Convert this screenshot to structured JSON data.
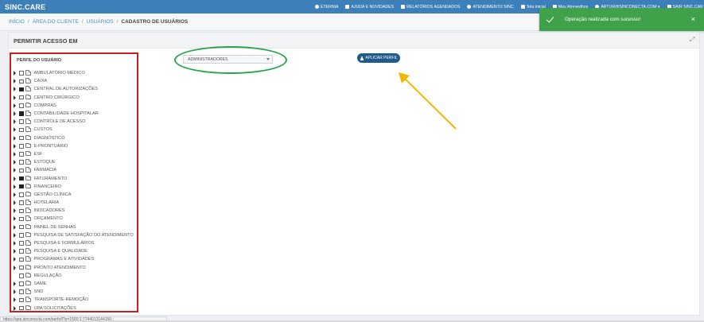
{
  "app": {
    "brand": "SINC.CARE"
  },
  "nav": [
    {
      "icon": "eternia-icon",
      "label": "ETERNIA"
    },
    {
      "icon": "help-icon",
      "label": "AJUDA E NOVIDADES"
    },
    {
      "icon": "report-icon",
      "label": "RELATÓRIOS AGENDADOS"
    },
    {
      "icon": "support-icon",
      "label": "ATENDIMENTO SINC"
    },
    {
      "icon": "home-icon",
      "label": "Tela Inicial"
    },
    {
      "icon": "shortcut-icon",
      "label": "Meu Atrevedhos"
    },
    {
      "icon": "user-icon",
      "label": "ARTUR@SINCONECTA.COM ▾"
    },
    {
      "icon": "logout-icon",
      "label": "SAIR SINC.CAR"
    }
  ],
  "breadcrumb": {
    "items": [
      "INÍCIO",
      "ÁREA DO CLIENTE",
      "USUÁRIOS"
    ],
    "separator": "/",
    "current": "CADASTRO DE USUÁRIOS"
  },
  "toast": {
    "message": "Operação realizada com sucesso!",
    "close": "×",
    "color": "#3fa24a"
  },
  "panel": {
    "title": "PERMITIR ACESSO EM"
  },
  "tree": {
    "title": "PERFIL DO USUÁRIO",
    "items": [
      {
        "label": "AMBULATÓRIO MÉDICO",
        "checked": false,
        "expandable": true
      },
      {
        "label": "CAIXA",
        "checked": false,
        "expandable": true
      },
      {
        "label": "CENTRAL DE AUTORIZAÇÕES",
        "checked": true,
        "expandable": true
      },
      {
        "label": "CENTRO CIRÚRGICO",
        "checked": false,
        "expandable": true
      },
      {
        "label": "COMPRAS",
        "checked": false,
        "expandable": true
      },
      {
        "label": "CONTABILIDADE HOSPITALAR",
        "checked": true,
        "expandable": true
      },
      {
        "label": "CONTROLE DE ACESSO",
        "checked": false,
        "expandable": true
      },
      {
        "label": "CUSTOS",
        "checked": false,
        "expandable": true
      },
      {
        "label": "DIAGNÓSTICO",
        "checked": false,
        "expandable": true
      },
      {
        "label": "E-PRONTUÁRIO",
        "checked": false,
        "expandable": true
      },
      {
        "label": "ESF",
        "checked": false,
        "expandable": true
      },
      {
        "label": "ESTOQUE",
        "checked": false,
        "expandable": true
      },
      {
        "label": "FARMÁCIA",
        "checked": false,
        "expandable": true
      },
      {
        "label": "FATURAMENTO",
        "checked": true,
        "expandable": true
      },
      {
        "label": "FINANCEIRO",
        "checked": true,
        "expandable": true
      },
      {
        "label": "GESTÃO CLÍNICA",
        "checked": false,
        "expandable": true
      },
      {
        "label": "HOTELARIA",
        "checked": false,
        "expandable": true
      },
      {
        "label": "INDICADORES",
        "checked": false,
        "expandable": true
      },
      {
        "label": "ORÇAMENTO",
        "checked": false,
        "expandable": true
      },
      {
        "label": "PAINEL DE SENHAS",
        "checked": false,
        "expandable": true
      },
      {
        "label": "PESQUISA DE SATISFAÇÃO DO ATENDIMENTO",
        "checked": false,
        "expandable": true
      },
      {
        "label": "PESQUISA E FORMULÁRIOS",
        "checked": false,
        "expandable": true
      },
      {
        "label": "PESQUISA E QUALIDADE",
        "checked": false,
        "expandable": true
      },
      {
        "label": "PROGRAMAS E ATIVIDADES",
        "checked": false,
        "expandable": true
      },
      {
        "label": "PRONTO ATENDIMENTO",
        "checked": false,
        "expandable": true
      },
      {
        "label": "REGULAÇÃO",
        "checked": false,
        "expandable": false
      },
      {
        "label": "SAME",
        "checked": false,
        "expandable": true
      },
      {
        "label": "SND",
        "checked": false,
        "expandable": true
      },
      {
        "label": "TRANSPORTE-REMOÇÃO",
        "checked": false,
        "expandable": true
      },
      {
        "label": "UPA SOLICITAÇÕES",
        "checked": false,
        "expandable": true
      }
    ]
  },
  "profile_select": {
    "value": "ADMINISTRADORES"
  },
  "apply_button": {
    "label": "APLICAR PERFIL"
  },
  "annotations": {
    "tree_outline_color": "#cc1f1f",
    "select_outline_color": "#27a34a",
    "arrow_color": "#f2b705"
  },
  "status_url": "https://app.sinconecta.com/perfs/f?p=1500:1:7744013144156::"
}
